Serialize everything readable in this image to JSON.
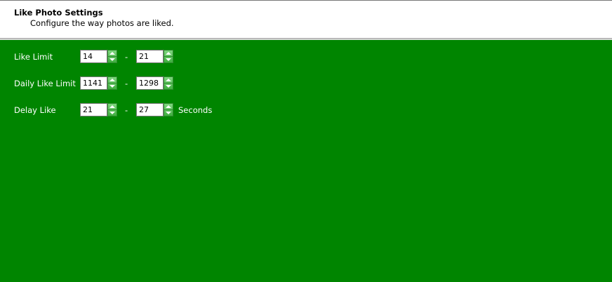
{
  "header": {
    "title": "Like Photo Settings",
    "description": "Configure the way photos are liked."
  },
  "rows": [
    {
      "label": "Like Limit",
      "min": "14",
      "max": "21",
      "separator": "-",
      "unit": ""
    },
    {
      "label": "Daily Like Limit",
      "min": "1141",
      "max": "1298",
      "separator": "-",
      "unit": ""
    },
    {
      "label": "Delay Like",
      "min": "21",
      "max": "27",
      "separator": "-",
      "unit": "Seconds"
    }
  ],
  "colors": {
    "background": "#008500",
    "header_bg": "#ffffff",
    "spinner_button": "#4cbb4c"
  },
  "icons": {
    "spin_up": "arrow-up-icon",
    "spin_down": "arrow-down-icon"
  }
}
